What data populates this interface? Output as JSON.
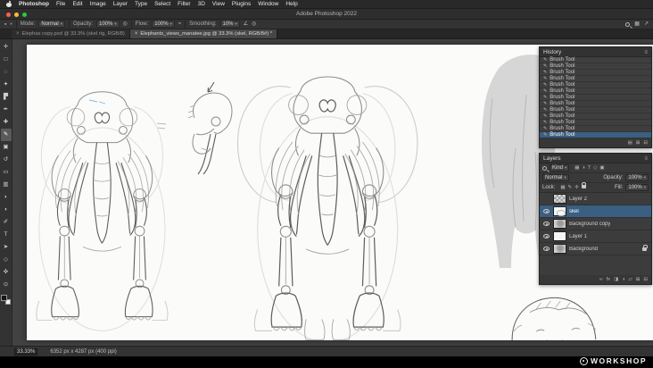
{
  "window": {
    "title": "Adobe Photoshop 2022"
  },
  "menubar": {
    "items": [
      "Photoshop",
      "File",
      "Edit",
      "Image",
      "Layer",
      "Type",
      "Select",
      "Filter",
      "3D",
      "View",
      "Plugins",
      "Window",
      "Help"
    ]
  },
  "options_bar": {
    "mode_label": "Mode:",
    "mode_value": "Normal",
    "opacity_label": "Opacity:",
    "opacity_value": "100%",
    "flow_label": "Flow:",
    "flow_value": "100%",
    "smoothing_label": "Smoothing:",
    "smoothing_value": "10%"
  },
  "tabs": [
    {
      "label": "Elephas copy.psd @ 33.3% (skel rig, RGB/8)",
      "active": false
    },
    {
      "label": "Elephants_views_manatee.jpg @ 33.3% (skel, RGB/8#) *",
      "active": true
    }
  ],
  "toolbar": {
    "tools": [
      {
        "name": "move-tool",
        "glyph": "✛"
      },
      {
        "name": "marquee-tool",
        "glyph": "□"
      },
      {
        "name": "lasso-tool",
        "glyph": "◌"
      },
      {
        "name": "quick-selection-tool",
        "glyph": "✦"
      },
      {
        "name": "crop-tool",
        "glyph": "▛"
      },
      {
        "name": "eyedropper-tool",
        "glyph": "✒"
      },
      {
        "name": "healing-brush-tool",
        "glyph": "✚"
      },
      {
        "name": "brush-tool",
        "glyph": "✎",
        "active": true
      },
      {
        "name": "clone-stamp-tool",
        "glyph": "▣"
      },
      {
        "name": "history-brush-tool",
        "glyph": "↺"
      },
      {
        "name": "eraser-tool",
        "glyph": "▭"
      },
      {
        "name": "gradient-tool",
        "glyph": "▥"
      },
      {
        "name": "blur-tool",
        "glyph": "◗"
      },
      {
        "name": "dodge-tool",
        "glyph": "◖"
      },
      {
        "name": "pen-tool",
        "glyph": "✐"
      },
      {
        "name": "type-tool",
        "glyph": "T"
      },
      {
        "name": "path-selection-tool",
        "glyph": "➤"
      },
      {
        "name": "shape-tool",
        "glyph": "◇"
      },
      {
        "name": "hand-tool",
        "glyph": "✜"
      },
      {
        "name": "zoom-tool",
        "glyph": "⊙"
      }
    ]
  },
  "history": {
    "title": "History",
    "selected_index": 12,
    "items": [
      {
        "label": "Brush Tool"
      },
      {
        "label": "Brush Tool"
      },
      {
        "label": "Brush Tool"
      },
      {
        "label": "Brush Tool"
      },
      {
        "label": "Brush Tool"
      },
      {
        "label": "Brush Tool"
      },
      {
        "label": "Brush Tool"
      },
      {
        "label": "Brush Tool"
      },
      {
        "label": "Brush Tool"
      },
      {
        "label": "Brush Tool"
      },
      {
        "label": "Brush Tool"
      },
      {
        "label": "Brush Tool"
      },
      {
        "label": "Brush Tool"
      }
    ]
  },
  "layers": {
    "title": "Layers",
    "kind_label": "Kind",
    "blend_value": "Normal",
    "opacity_label": "Opacity:",
    "opacity_value": "100%",
    "lock_label": "Lock:",
    "fill_label": "Fill:",
    "fill_value": "100%",
    "items": [
      {
        "name": "Layer 2",
        "visible": false,
        "selected": false,
        "locked": false
      },
      {
        "name": "skel",
        "visible": true,
        "selected": true,
        "locked": false
      },
      {
        "name": "Background copy",
        "visible": true,
        "selected": false,
        "locked": false
      },
      {
        "name": "Layer 1",
        "visible": true,
        "selected": false,
        "locked": false
      },
      {
        "name": "Background",
        "visible": true,
        "selected": false,
        "locked": true
      }
    ]
  },
  "status_bar": {
    "zoom": "33.33%",
    "doc_info": "6352 px x 4287 px (400 ppi)"
  },
  "watermark": {
    "text": "WORKSHOP"
  },
  "colors": {
    "selection_blue": "#3a5f82",
    "canvas_surround": "#424242",
    "panel_bg": "#3a3a3a",
    "traffic_close": "#ff5f57",
    "traffic_minimize": "#febc2e",
    "traffic_zoom": "#28c840"
  }
}
